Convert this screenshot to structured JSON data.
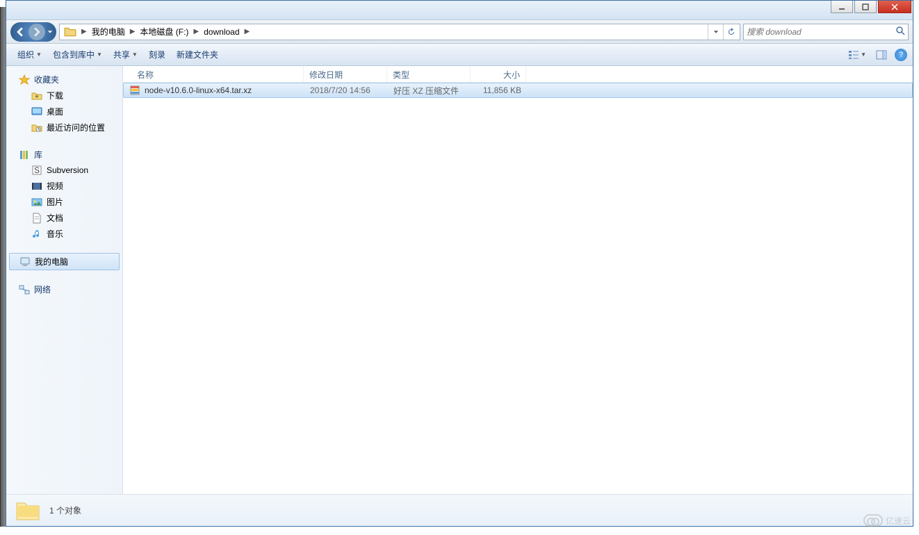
{
  "titlebar": {
    "title": ""
  },
  "breadcrumbs": [
    {
      "label": "我的电脑"
    },
    {
      "label": "本地磁盘 (F:)"
    },
    {
      "label": "download"
    }
  ],
  "search": {
    "placeholder": "搜索 download"
  },
  "toolbar": {
    "organize": "组织",
    "include": "包含到库中",
    "share": "共享",
    "burn": "刻录",
    "newfolder": "新建文件夹"
  },
  "sidebar": {
    "favorites": {
      "label": "收藏夹",
      "items": [
        {
          "label": "下载",
          "icon": "download"
        },
        {
          "label": "桌面",
          "icon": "desktop"
        },
        {
          "label": "最近访问的位置",
          "icon": "recent"
        }
      ]
    },
    "libraries": {
      "label": "库",
      "items": [
        {
          "label": "Subversion",
          "icon": "svn"
        },
        {
          "label": "视频",
          "icon": "video"
        },
        {
          "label": "图片",
          "icon": "picture"
        },
        {
          "label": "文档",
          "icon": "document"
        },
        {
          "label": "音乐",
          "icon": "music"
        }
      ]
    },
    "computer": {
      "label": "我的电脑"
    },
    "network": {
      "label": "网络"
    }
  },
  "columns": {
    "name": "名称",
    "date": "修改日期",
    "type": "类型",
    "size": "大小"
  },
  "files": [
    {
      "name": "node-v10.6.0-linux-x64.tar.xz",
      "date": "2018/7/20 14:56",
      "type": "好压 XZ 压缩文件",
      "size": "11,856 KB"
    }
  ],
  "status": {
    "text": "1 个对象"
  },
  "watermark": "亿速云"
}
